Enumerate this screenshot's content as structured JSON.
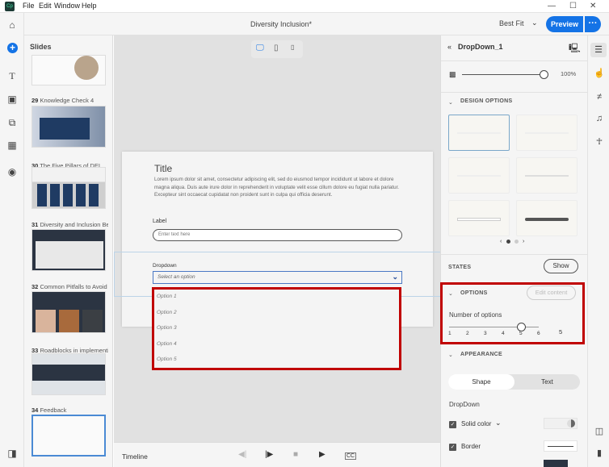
{
  "menubar": {
    "app_icon": "Cp",
    "items": [
      "File",
      "Edit",
      "Window",
      "Help"
    ],
    "window_controls": [
      "—",
      "☐",
      "✕"
    ]
  },
  "header": {
    "document_title": "Diversity Inclusion*",
    "zoom": "Best Fit",
    "preview_label": "Preview",
    "more_label": "···"
  },
  "rail": {
    "icons": [
      "home-icon",
      "add-icon",
      "text-icon",
      "media-icon",
      "interactions-icon",
      "widgets-icon",
      "record-icon",
      "panel-icon"
    ]
  },
  "slides_panel": {
    "title": "Slides",
    "items": [
      {
        "num": "29",
        "label": "Knowledge Check 4"
      },
      {
        "num": "30",
        "label": "The Five Pillars of DEI"
      },
      {
        "num": "31",
        "label": "Diversity and Inclusion Bes..."
      },
      {
        "num": "32",
        "label": "Common Pitfalls to Avoid"
      },
      {
        "num": "33",
        "label": "Roadblocks in implementi..."
      },
      {
        "num": "34",
        "label": "Feedback"
      }
    ]
  },
  "slide": {
    "title": "Title",
    "body": "Lorem ipsum dolor sit amet, consectetur adipiscing elit, sed do eiusmod tempor incididunt ut labore et dolore magna aliqua. Duis aute irure dolor in reprehenderit in voluptate velit esse cillum dolore eu fugiat nulla pariatur. Excepteur sint occaecat cupidatat non proident sunt in culpa qui officia deserunt.",
    "label": "Label",
    "text_placeholder": "Enter text here",
    "dropdown_label": "Dropdown",
    "dropdown_placeholder": "Select an option",
    "options": [
      "Option 1",
      "Option 2",
      "Option 3",
      "Option 4",
      "Option 5"
    ]
  },
  "timeline": {
    "label": "Timeline"
  },
  "properties": {
    "object_name": "DropDown_1",
    "opacity": "100%",
    "opacity_value": 100,
    "design_options": "DESIGN OPTIONS",
    "states": "STATES",
    "show_label": "Show",
    "options_section": "OPTIONS",
    "edit_content": "Edit content",
    "number_of_options_label": "Number of options",
    "slider_ticks": [
      "1",
      "2",
      "3",
      "4",
      "5",
      "6"
    ],
    "number_of_options": "5",
    "appearance": "APPEARANCE",
    "tabs": [
      "Shape",
      "Text"
    ],
    "active_tab": "Shape",
    "dropdown_heading": "DropDown",
    "solid_color": "Solid color",
    "border": "Border"
  },
  "colors": {
    "accent": "#1473e6",
    "highlight": "#c00000"
  }
}
